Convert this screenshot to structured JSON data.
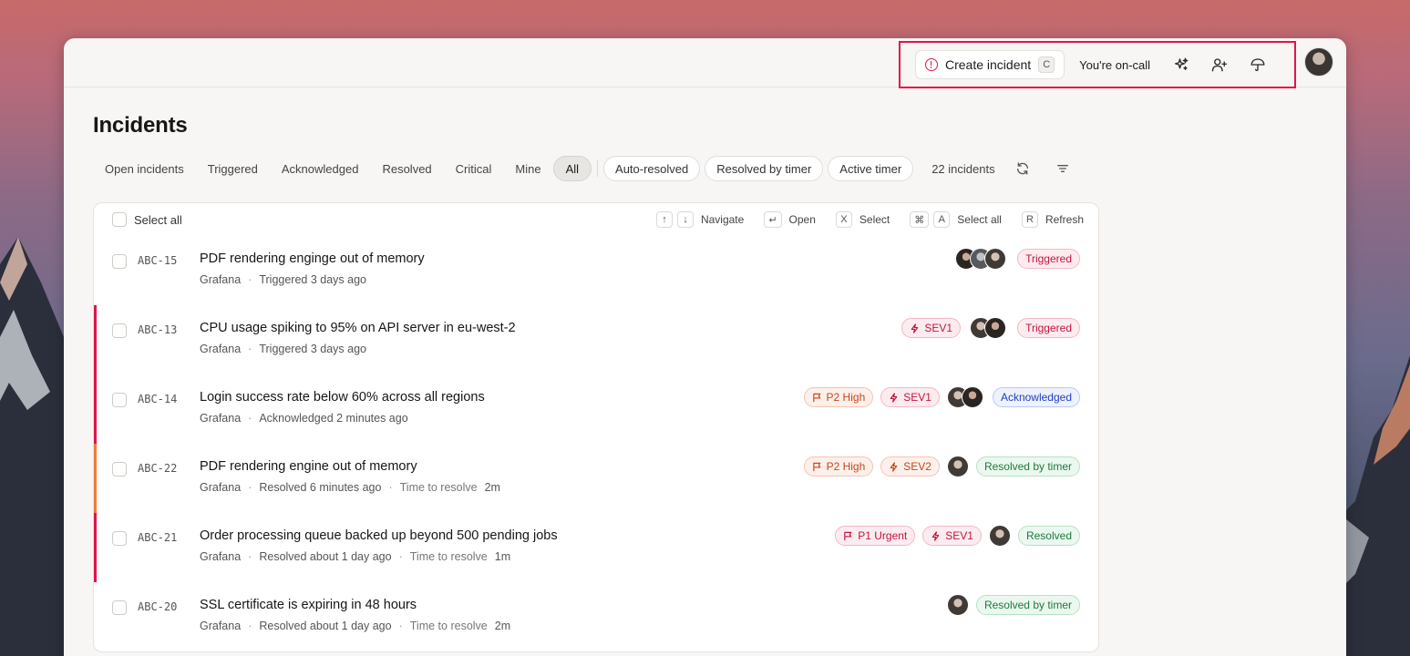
{
  "topbar": {
    "create_label": "Create incident",
    "create_shortcut": "C",
    "oncall_label": "You're on-call"
  },
  "page": {
    "title": "Incidents"
  },
  "filters": {
    "tabs": [
      "Open incidents",
      "Triggered",
      "Acknowledged",
      "Resolved",
      "Critical",
      "Mine",
      "All"
    ],
    "active_tab": "All",
    "pills": [
      "Auto-resolved",
      "Resolved by timer",
      "Active timer"
    ],
    "count_label": "22 incidents"
  },
  "list_head": {
    "select_all": "Select all",
    "shortcuts": {
      "up_key": "↑",
      "down_key": "↓",
      "navigate": "Navigate",
      "open_key": "↵",
      "open": "Open",
      "select_key": "X",
      "select": "Select",
      "cmd_key": "⌘",
      "a_key": "A",
      "select_all": "Select all",
      "refresh_key": "R",
      "refresh": "Refresh"
    }
  },
  "incidents": [
    {
      "id": "ABC-15",
      "title": "PDF rendering enginge out of memory",
      "source": "Grafana",
      "status_text": "Triggered 3 days ago",
      "ttr_label": "",
      "ttr": "",
      "priority": "",
      "severity": "",
      "status": "Triggered"
    },
    {
      "id": "ABC-13",
      "title": "CPU usage spiking to 95% on API server in eu-west-2",
      "source": "Grafana",
      "status_text": "Triggered 3 days ago",
      "ttr_label": "",
      "ttr": "",
      "priority": "",
      "severity": "SEV1",
      "status": "Triggered"
    },
    {
      "id": "ABC-14",
      "title": "Login success rate below 60% across all regions",
      "source": "Grafana",
      "status_text": "Acknowledged 2 minutes ago",
      "ttr_label": "",
      "ttr": "",
      "priority": "P2 High",
      "severity": "SEV1",
      "status": "Acknowledged"
    },
    {
      "id": "ABC-22",
      "title": "PDF rendering engine out of memory",
      "source": "Grafana",
      "status_text": "Resolved 6 minutes ago",
      "ttr_label": "Time to resolve",
      "ttr": "2m",
      "priority": "P2 High",
      "severity": "SEV2",
      "status": "Resolved by timer"
    },
    {
      "id": "ABC-21",
      "title": "Order processing queue backed up beyond 500 pending jobs",
      "source": "Grafana",
      "status_text": "Resolved about 1 day ago",
      "ttr_label": "Time to resolve",
      "ttr": "1m",
      "priority": "P1 Urgent",
      "severity": "SEV1",
      "status": "Resolved"
    },
    {
      "id": "ABC-20",
      "title": "SSL certificate is expiring in 48 hours",
      "source": "Grafana",
      "status_text": "Resolved about 1 day ago",
      "ttr_label": "Time to resolve",
      "ttr": "2m",
      "priority": "",
      "severity": "",
      "status": "Resolved by timer"
    }
  ],
  "colors": {
    "accent": "#e0144c",
    "sev1_stripe": "#e0144c",
    "sev2_stripe": "#f07a3a"
  }
}
